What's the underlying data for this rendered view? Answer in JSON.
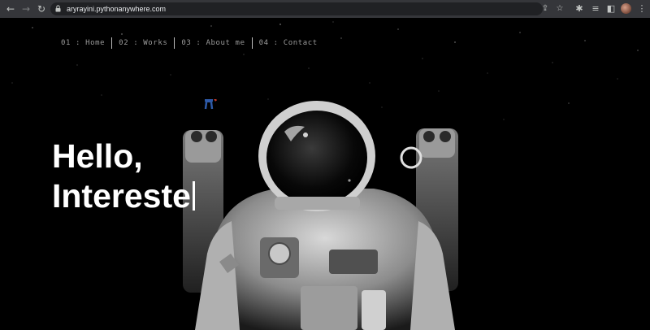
{
  "browser": {
    "url": "aryrayini.pythonanywhere.com",
    "icons": [
      "back-icon",
      "forward-icon",
      "reload-icon",
      "lock-icon",
      "share-icon",
      "star-icon",
      "extensions-icon",
      "reading-list-icon",
      "side-panel-icon",
      "profile-avatar",
      "menu-dots-icon"
    ]
  },
  "nav": {
    "items": [
      {
        "label": "01 : Home"
      },
      {
        "label": "02 : Works"
      },
      {
        "label": "03 : About me"
      },
      {
        "label": "04 : Contact"
      }
    ]
  },
  "hero": {
    "line1": "Hello,",
    "line2": "Intereste"
  },
  "colors": {
    "background": "#000000",
    "chrome": "#35363a",
    "omnibox": "#202124",
    "text": "#ffffff",
    "nav_text": "#9a9a9a"
  }
}
